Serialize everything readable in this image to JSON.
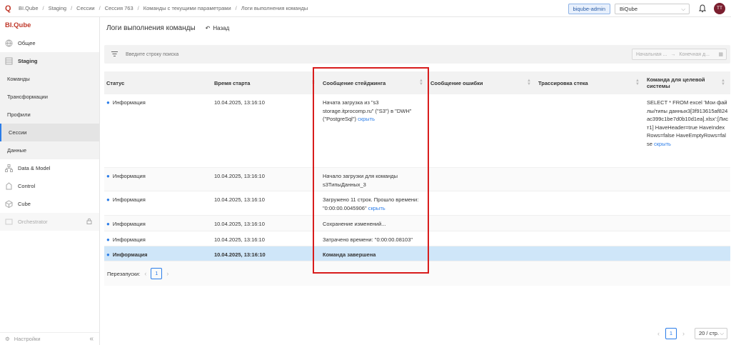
{
  "header": {
    "logo": "Q",
    "breadcrumbs": [
      "BI.Qube",
      "Staging",
      "Сессии",
      "Сессия 763",
      "Команды с текущими параметрами",
      "Логи выполнения команды"
    ],
    "user": "biqube-admin",
    "workspace": "BiQube",
    "avatar": "TT"
  },
  "sidebar": {
    "brand": "BI.Qube",
    "items": [
      {
        "label": "Общее"
      },
      {
        "label": "Staging"
      },
      {
        "label": "Команды"
      },
      {
        "label": "Трансформации"
      },
      {
        "label": "Профили"
      },
      {
        "label": "Сессии"
      },
      {
        "label": "Данные"
      },
      {
        "label": "Data & Model"
      },
      {
        "label": "Control"
      },
      {
        "label": "Cube"
      },
      {
        "label": "Orchestrator"
      }
    ],
    "settings": "Настройки"
  },
  "page": {
    "title": "Логи выполнения команды",
    "back": "Назад"
  },
  "filters": {
    "search_placeholder": "Введите строку поиска",
    "date_start": "Начальная ...",
    "date_end": "Конечная д..."
  },
  "table": {
    "columns": [
      "Статус",
      "Время старта",
      "Сообщение стейджинга",
      "Сообщение ошибки",
      "Трассировка стека",
      "Команда для целевой системы"
    ],
    "hide_label": "скрыть",
    "rows": [
      {
        "status": "Информация",
        "time": "10.04.2025, 13:16:10",
        "message": "Начата загрузка из \"s3 storage.itprocomp.ru\" (\"S3\") в \"DWH\" (\"PostgreSql\")",
        "error": "",
        "trace": "",
        "command": "SELECT * FROM excel 'Мои файлы/типы данных3[3f913615af824ac399c1be7d0b10d1ea].xlsx':[Лист1] HaveHeader=true HaveIndexRows=false HaveEmptyRows=false"
      },
      {
        "status": "Информация",
        "time": "10.04.2025, 13:16:10",
        "message": "Начало загрузки для команды s3ТипыДанных_3",
        "error": "",
        "trace": "",
        "command": ""
      },
      {
        "status": "Информация",
        "time": "10.04.2025, 13:16:10",
        "message": "Загружено 11 строк. Прошло времени: \"0:00:00.0045906\"",
        "error": "",
        "trace": "",
        "command": ""
      },
      {
        "status": "Информация",
        "time": "10.04.2025, 13:16:10",
        "message": "Сохранение изменений...",
        "error": "",
        "trace": "",
        "command": ""
      },
      {
        "status": "Информация",
        "time": "10.04.2025, 13:16:10",
        "message": "Затрачено времени: \"0:00:00.08103\"",
        "error": "",
        "trace": "",
        "command": ""
      },
      {
        "status": "Информация",
        "time": "10.04.2025, 13:16:10",
        "message": "Команда завершена",
        "error": "",
        "trace": "",
        "command": ""
      }
    ],
    "restarts_label": "Перезапуски:",
    "restarts_page": "1"
  },
  "pagination": {
    "page": "1",
    "per_page": "20 / стр."
  },
  "colors": {
    "accent": "#2b7de9",
    "highlight": "#d81c1c",
    "selected_row": "#cfe6f9",
    "brand": "#c0392b"
  }
}
